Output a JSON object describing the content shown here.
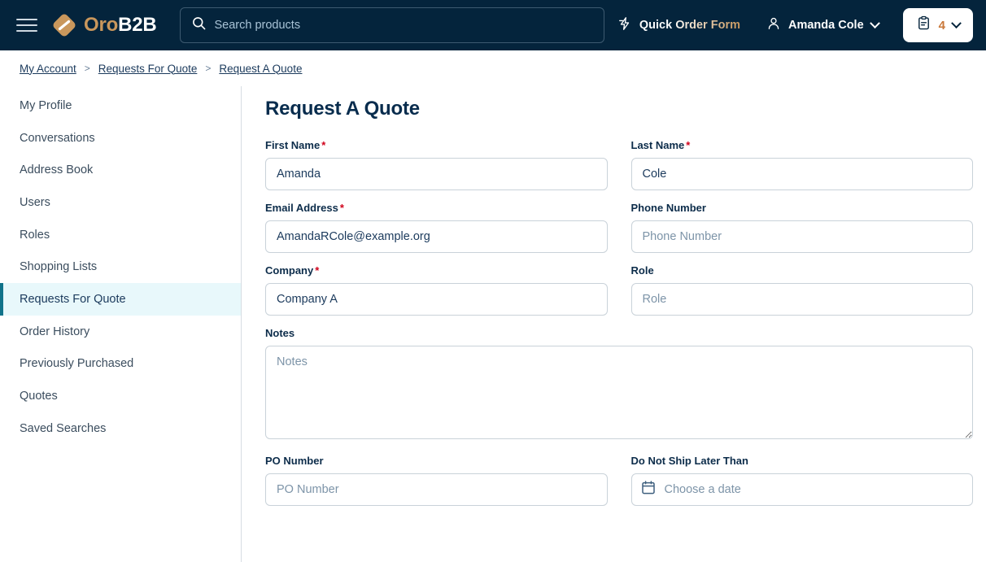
{
  "header": {
    "menu_icon": "hamburger-menu-icon",
    "brand": {
      "icon": "oro-diamond-logo-icon",
      "text_primary": "Oro",
      "text_secondary": "B2B"
    },
    "search": {
      "icon": "search-icon",
      "placeholder": "Search products",
      "value": ""
    },
    "quick_order": {
      "icon": "lightning-bolt-icon",
      "label": "Quick Order Form"
    },
    "account": {
      "icon": "user-person-icon",
      "label": "Amanda Cole",
      "chevron": "chevron-down-icon"
    },
    "cart": {
      "icon": "clipboard-list-icon",
      "count": "4",
      "chevron": "chevron-down-icon"
    },
    "colors": {
      "background": "#04243c",
      "brand_gold": "#c9975c",
      "count_orange": "#c9783a"
    }
  },
  "breadcrumb": {
    "separator": ">",
    "items": [
      {
        "label": "My Account"
      },
      {
        "label": "Requests For Quote"
      },
      {
        "label": "Request A Quote"
      }
    ]
  },
  "sidebar": {
    "active_index": 6,
    "items": [
      {
        "label": "My Profile"
      },
      {
        "label": "Conversations"
      },
      {
        "label": "Address Book"
      },
      {
        "label": "Users"
      },
      {
        "label": "Roles"
      },
      {
        "label": "Shopping Lists"
      },
      {
        "label": "Requests For Quote"
      },
      {
        "label": "Order History"
      },
      {
        "label": "Previously Purchased"
      },
      {
        "label": "Quotes"
      },
      {
        "label": "Saved Searches"
      }
    ],
    "colors": {
      "active_background": "#e8f8fb",
      "active_border": "#11738a"
    }
  },
  "main": {
    "title": "Request A Quote",
    "required_marker": "*",
    "fields": {
      "first_name": {
        "label": "First Name",
        "required": true,
        "value": "Amanda",
        "placeholder": "First Name"
      },
      "last_name": {
        "label": "Last Name",
        "required": true,
        "value": "Cole",
        "placeholder": "Last Name"
      },
      "email": {
        "label": "Email Address",
        "required": true,
        "value": "AmandaRCole@example.org",
        "placeholder": "Email Address"
      },
      "phone": {
        "label": "Phone Number",
        "required": false,
        "value": "",
        "placeholder": "Phone Number"
      },
      "company": {
        "label": "Company",
        "required": true,
        "value": "Company A",
        "placeholder": "Company"
      },
      "role": {
        "label": "Role",
        "required": false,
        "value": "",
        "placeholder": "Role"
      },
      "notes": {
        "label": "Notes",
        "required": false,
        "value": "",
        "placeholder": "Notes"
      },
      "po_number": {
        "label": "PO Number",
        "required": false,
        "value": "",
        "placeholder": "PO Number"
      },
      "ship_date": {
        "label": "Do Not Ship Later Than",
        "required": false,
        "value": "",
        "placeholder": "Choose a date",
        "icon": "calendar-icon"
      }
    }
  }
}
